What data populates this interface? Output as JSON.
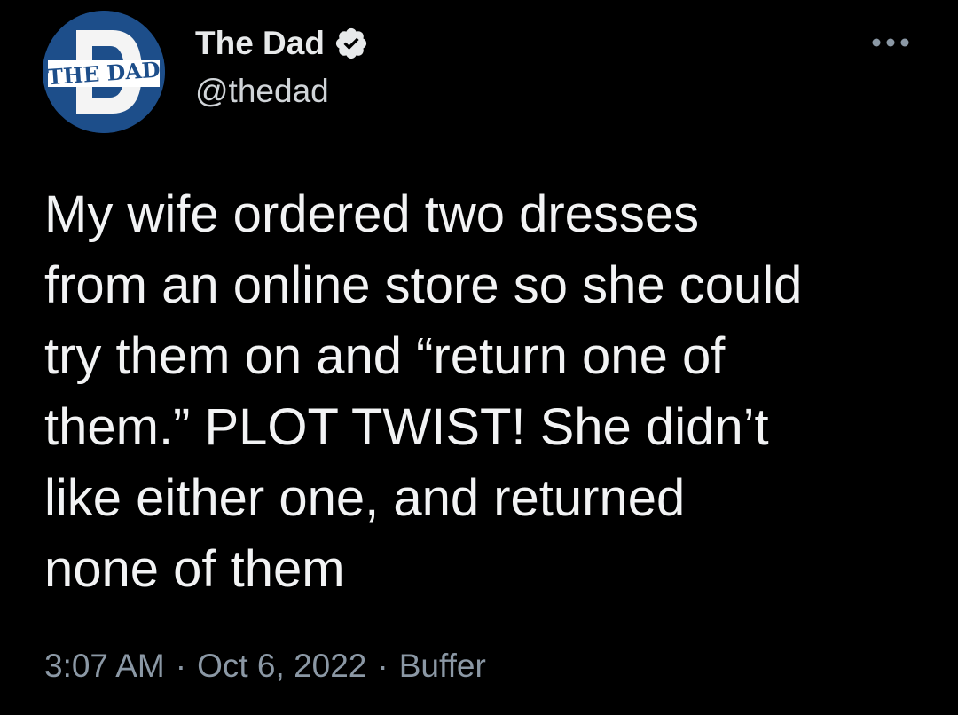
{
  "tweet": {
    "author": {
      "display_name": "The Dad",
      "handle": "@thedad",
      "verified": true,
      "avatar_icon": "the-dad-logo",
      "avatar_text": "THE DAD",
      "avatar_bg": "#1d4e8a"
    },
    "more_icon": "more-horizontal-icon",
    "text": "My wife ordered two dresses\nfrom an online store so she could\ntry them on and “return one of\nthem.” PLOT TWIST! She didn’t\nlike either one, and returned\nnone of them",
    "time": "3:07 AM",
    "date": "Oct 6, 2022",
    "separator": "·",
    "source": "Buffer"
  },
  "colors": {
    "background": "#000000",
    "text_primary": "#e7e9ea",
    "text_secondary": "#8b98a5",
    "verified_badge": "#e7e9ea"
  }
}
